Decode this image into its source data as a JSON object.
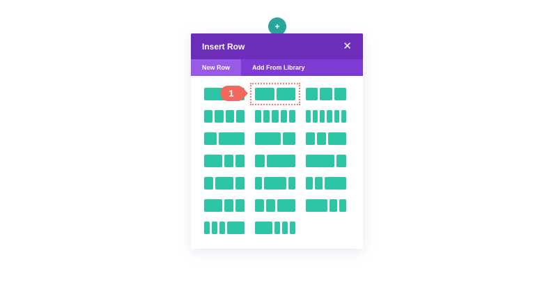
{
  "top_button": {
    "icon": "plus-icon",
    "glyph": "+"
  },
  "modal": {
    "title": "Insert Row",
    "close_glyph": "✕",
    "tabs": [
      {
        "label": "New Row",
        "active": true
      },
      {
        "label": "Add From Library",
        "active": false
      }
    ]
  },
  "callout": {
    "label": "1",
    "color": "#f2675e"
  },
  "colors": {
    "header": "#6c2eb9",
    "tabs_bar": "#7d3bd3",
    "active_tab": "#9a5ae8",
    "column": "#2ec4a6",
    "highlight_border": "#f07f78",
    "add_button": "#29a59a"
  },
  "layouts": [
    {
      "cols": [
        1
      ],
      "highlighted": false
    },
    {
      "cols": [
        1,
        1
      ],
      "highlighted": true
    },
    {
      "cols": [
        1,
        1,
        1
      ],
      "highlighted": false
    },
    {
      "cols": [
        1,
        1,
        1,
        1
      ],
      "highlighted": false
    },
    {
      "cols": [
        1,
        1,
        1,
        1,
        1
      ],
      "highlighted": false
    },
    {
      "cols": [
        1,
        1,
        1,
        1,
        1,
        1
      ],
      "highlighted": false
    },
    {
      "cols": [
        1,
        2
      ],
      "highlighted": false
    },
    {
      "cols": [
        2,
        1
      ],
      "highlighted": false
    },
    {
      "cols": [
        1,
        1,
        2
      ],
      "highlighted": false
    },
    {
      "cols": [
        2,
        1,
        1
      ],
      "highlighted": false
    },
    {
      "cols": [
        1,
        3
      ],
      "highlighted": false
    },
    {
      "cols": [
        3,
        1
      ],
      "highlighted": false
    },
    {
      "cols": [
        1,
        2,
        1
      ],
      "highlighted": false
    },
    {
      "cols": [
        1,
        3,
        1
      ],
      "highlighted": false
    },
    {
      "cols": [
        1,
        1,
        3
      ],
      "highlighted": false
    },
    {
      "cols": [
        2,
        1,
        1
      ],
      "highlighted": false
    },
    {
      "cols": [
        1,
        1,
        2
      ],
      "highlighted": false
    },
    {
      "cols": [
        3,
        1,
        1
      ],
      "highlighted": false
    },
    {
      "cols": [
        1,
        1,
        1,
        3
      ],
      "highlighted": false
    },
    {
      "cols": [
        3,
        1,
        1,
        1
      ],
      "highlighted": false
    }
  ]
}
